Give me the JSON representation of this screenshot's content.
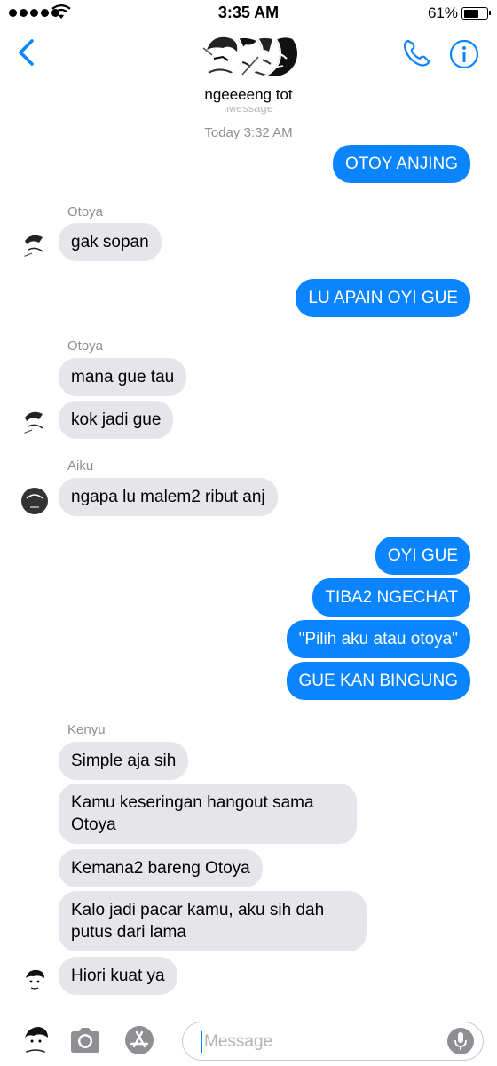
{
  "status_bar": {
    "time": "3:35 AM",
    "battery": "61%"
  },
  "header": {
    "group_name": "ngeeeeng tot"
  },
  "thread": {
    "clipped_label": "iMessage",
    "timestamp": "Today 3:32 AM",
    "messages": [
      {
        "dir": "out",
        "text": "OTOY ANJING"
      },
      {
        "dir": "in",
        "sender": "Otoya",
        "text": "gak sopan"
      },
      {
        "dir": "out",
        "text": "LU APAIN OYI GUE"
      },
      {
        "dir": "in",
        "sender": "Otoya",
        "text": "mana gue tau"
      },
      {
        "dir": "in",
        "text": "kok jadi gue"
      },
      {
        "dir": "in",
        "sender": "Aiku",
        "text": "ngapa lu malem2 ribut anj"
      },
      {
        "dir": "out",
        "text": "OYI GUE"
      },
      {
        "dir": "out",
        "text": "TIBA2 NGECHAT"
      },
      {
        "dir": "out",
        "text": "\"Pilih aku atau otoya\""
      },
      {
        "dir": "out",
        "text": "GUE KAN BINGUNG"
      },
      {
        "dir": "in",
        "sender": "Kenyu",
        "text": "Simple aja sih"
      },
      {
        "dir": "in",
        "text": "Kamu keseringan hangout sama Otoya"
      },
      {
        "dir": "in",
        "text": "Kemana2 bareng Otoya"
      },
      {
        "dir": "in",
        "text": "Kalo jadi pacar kamu, aku sih dah putus dari lama"
      },
      {
        "dir": "in",
        "text": "Hiori kuat ya"
      }
    ]
  },
  "composer": {
    "placeholder": "Message"
  },
  "colors": {
    "outgoing_bubble": "#0b84ff",
    "incoming_bubble": "#e5e5ea",
    "accent": "#0b84ff"
  },
  "icons": [
    "back-chevron-icon",
    "phone-icon",
    "info-icon",
    "camera-icon",
    "app-store-icon",
    "microphone-icon",
    "wifi-icon"
  ]
}
